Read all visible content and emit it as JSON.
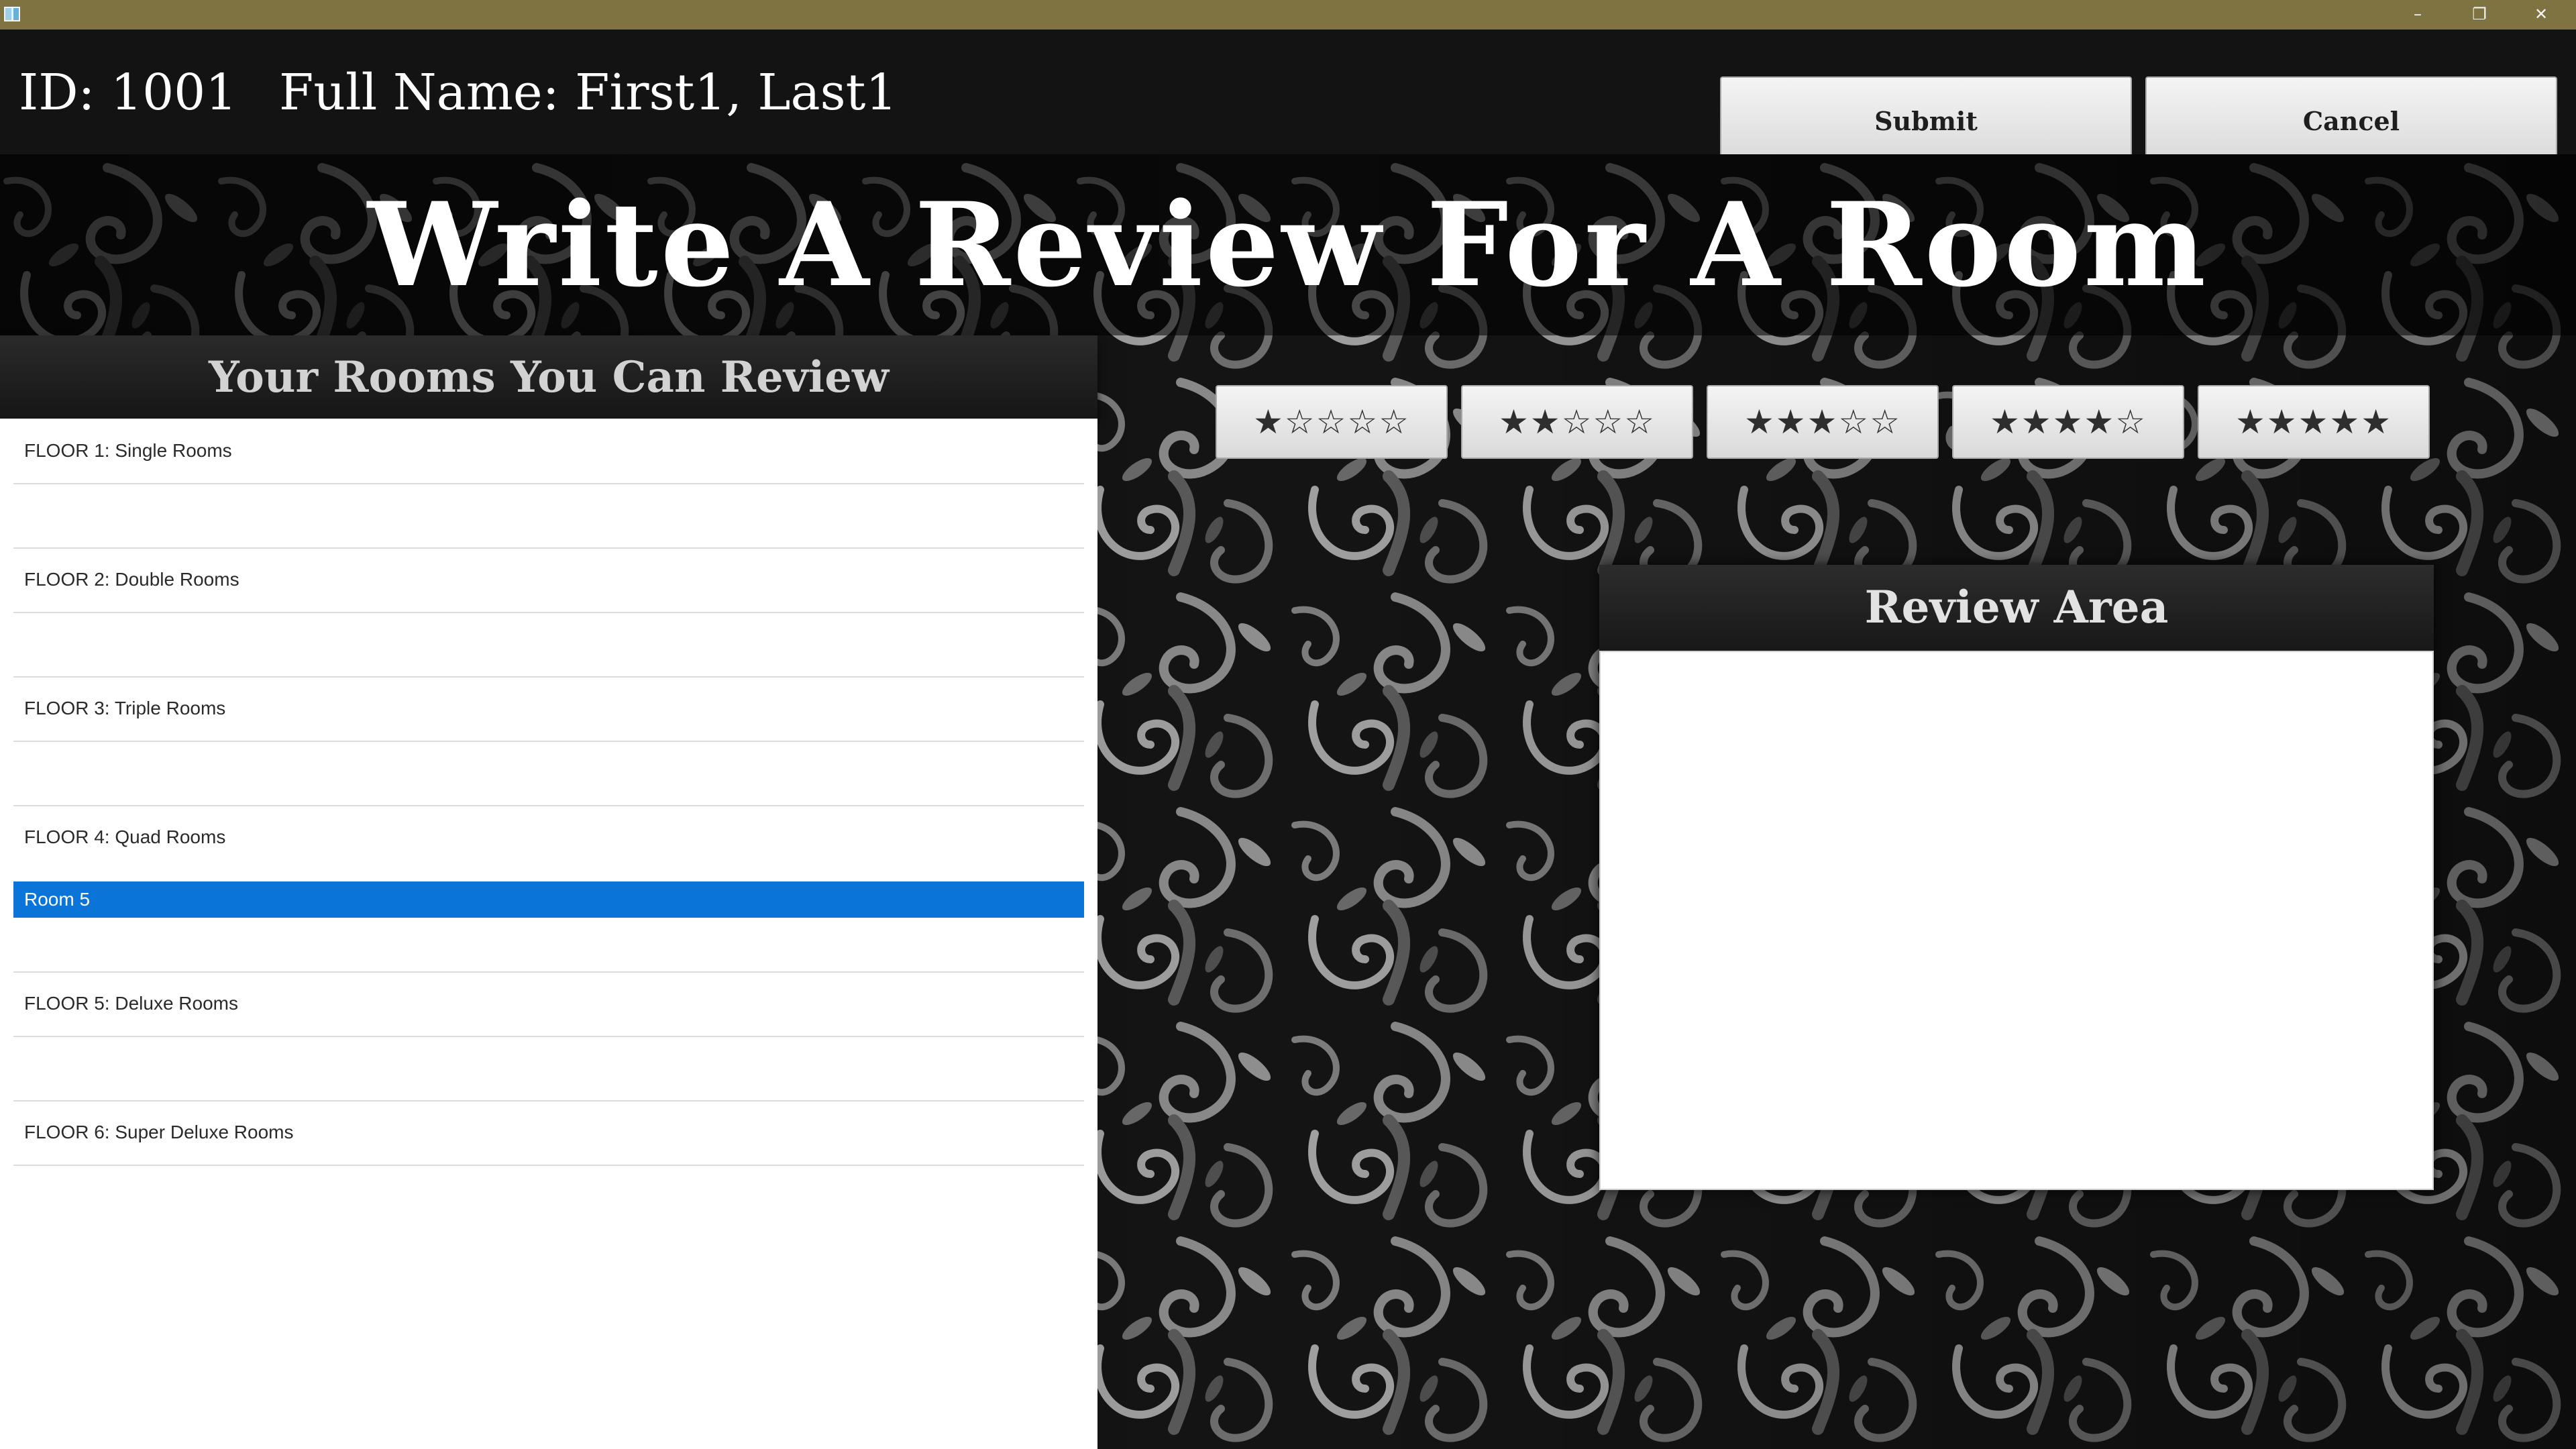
{
  "window": {
    "minimize_glyph": "–",
    "maximize_glyph": "❐",
    "close_glyph": "✕"
  },
  "header": {
    "id_text": "ID: 1001",
    "name_text": "Full Name: First1, Last1",
    "submit_label": "Submit",
    "cancel_label": "Cancel"
  },
  "page": {
    "title": "Write A Review For A Room"
  },
  "rooms_panel": {
    "header": "Your Rooms You Can Review",
    "items": [
      {
        "label": "FLOOR 1: Single Rooms",
        "selected": false
      },
      {
        "label": "",
        "selected": false
      },
      {
        "label": "FLOOR 2: Double Rooms",
        "selected": false
      },
      {
        "label": "",
        "selected": false
      },
      {
        "label": "FLOOR 3: Triple Rooms",
        "selected": false
      },
      {
        "label": "",
        "selected": false
      },
      {
        "label": "FLOOR 4: Quad Rooms",
        "selected": false
      },
      {
        "label": "Room 5",
        "selected": true
      },
      {
        "label": "",
        "selected": false
      },
      {
        "label": "FLOOR 5: Deluxe Rooms",
        "selected": false
      },
      {
        "label": "",
        "selected": false
      },
      {
        "label": "FLOOR 6: Super Deluxe Rooms",
        "selected": false
      }
    ],
    "selected_color": "#0a74d8"
  },
  "rating": {
    "options": [
      {
        "label": "★☆☆☆☆",
        "stars": 1
      },
      {
        "label": "★★☆☆☆",
        "stars": 2
      },
      {
        "label": "★★★☆☆",
        "stars": 3
      },
      {
        "label": "★★★★☆",
        "stars": 4
      },
      {
        "label": "★★★★★",
        "stars": 5
      }
    ]
  },
  "review": {
    "header": "Review Area",
    "value": ""
  },
  "colors": {
    "titlebar": "#7f7441",
    "header_bg": "#131313",
    "accent_selected": "#0a74d8"
  }
}
